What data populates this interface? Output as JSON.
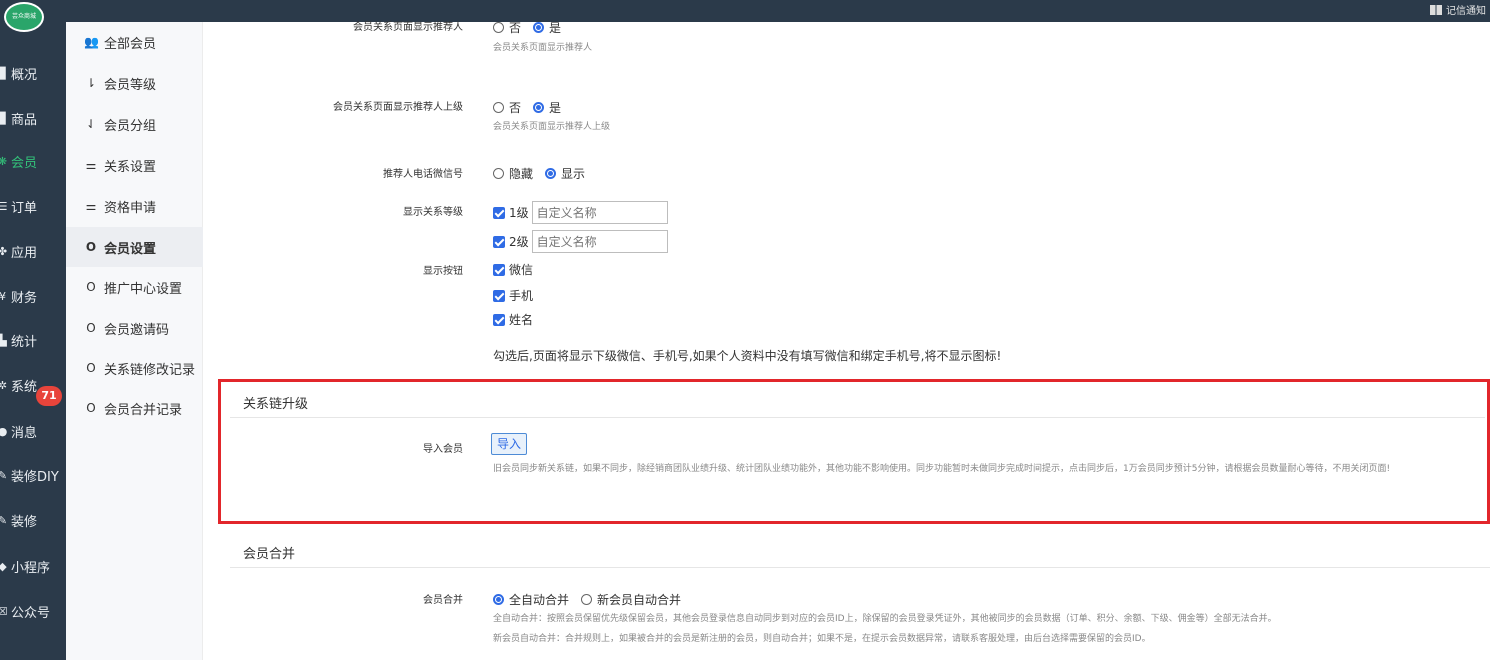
{
  "topbar": {
    "logo_text": "芸众商城",
    "right_text": "记信通知"
  },
  "sidebar": {
    "items": [
      {
        "label": "概况",
        "icon": "overview-icon",
        "glyph": "▉"
      },
      {
        "label": "商品",
        "icon": "goods-icon",
        "glyph": "▉"
      },
      {
        "label": "会员",
        "icon": "member-icon",
        "glyph": "❋"
      },
      {
        "label": "订单",
        "icon": "order-icon",
        "glyph": "☰"
      },
      {
        "label": "应用",
        "icon": "app-icon",
        "glyph": "✤"
      },
      {
        "label": "财务",
        "icon": "finance-icon",
        "glyph": "¥"
      },
      {
        "label": "统计",
        "icon": "stats-icon",
        "glyph": "▙"
      },
      {
        "label": "系统",
        "icon": "system-icon",
        "glyph": "✲"
      },
      {
        "label": "消息",
        "icon": "message-icon",
        "glyph": "●"
      },
      {
        "label": "装修DIY",
        "icon": "diy-icon",
        "glyph": "✎"
      },
      {
        "label": "装修",
        "icon": "decorate-icon",
        "glyph": "✎"
      },
      {
        "label": "小程序",
        "icon": "miniprogram-icon",
        "glyph": "◆"
      },
      {
        "label": "公众号",
        "icon": "official-account-icon",
        "glyph": "☒"
      }
    ],
    "active_index": 2,
    "message_badge": "71"
  },
  "submenu": {
    "items": [
      {
        "label": "全部会员",
        "glyph": "👥"
      },
      {
        "label": "会员等级",
        "glyph": "⇂"
      },
      {
        "label": "会员分组",
        "glyph": "⇃"
      },
      {
        "label": "关系设置",
        "glyph": "⚌"
      },
      {
        "label": "资格申请",
        "glyph": "⚌"
      },
      {
        "label": "会员设置",
        "glyph": "O"
      },
      {
        "label": "推广中心设置",
        "glyph": "O"
      },
      {
        "label": "会员邀请码",
        "glyph": "O"
      },
      {
        "label": "关系链修改记录",
        "glyph": "O"
      },
      {
        "label": "会员合并记录",
        "glyph": "O"
      }
    ],
    "current_index": 5
  },
  "form": {
    "show_referrer": {
      "label": "会员关系页面显示推荐人",
      "options": [
        "否",
        "是"
      ],
      "selected": "是",
      "help": "会员关系页面显示推荐人"
    },
    "show_referrer_parent": {
      "label": "会员关系页面显示推荐人上级",
      "options": [
        "否",
        "是"
      ],
      "selected": "是",
      "help": "会员关系页面显示推荐人上级"
    },
    "referrer_contact": {
      "label": "推荐人电话微信号",
      "options": [
        "隐藏",
        "显示"
      ],
      "selected": "显示"
    },
    "relation_levels": {
      "label": "显示关系等级",
      "levels": [
        {
          "label": "1级",
          "placeholder": "自定义名称",
          "checked": true
        },
        {
          "label": "2级",
          "placeholder": "自定义名称",
          "checked": true
        }
      ]
    },
    "display_buttons": {
      "label": "显示按钮",
      "items": [
        {
          "label": "微信",
          "checked": true
        },
        {
          "label": "手机",
          "checked": true
        },
        {
          "label": "姓名",
          "checked": true
        }
      ],
      "notice": "勾选后,页面将显示下级微信、手机号,如果个人资料中没有填写微信和绑定手机号,将不显示图标!"
    }
  },
  "chain_upgrade": {
    "title": "关系链升级",
    "import_label": "导入会员",
    "import_button": "导入",
    "help": "旧会员同步新关系链，如果不同步，除经销商团队业绩升级、统计团队业绩功能外，其他功能不影响使用。同步功能暂时未做同步完成时间提示，点击同步后，1万会员同步预计5分钟，请根据会员数量耐心等待，不用关闭页面!"
  },
  "member_merge": {
    "title": "会员合并",
    "label": "会员合并",
    "options": [
      "全自动合并",
      "新会员自动合并"
    ],
    "selected": "全自动合并",
    "help1": "全自动合并：按照会员保留优先级保留会员，其他会员登录信息自动同步到对应的会员ID上，除保留的会员登录凭证外，其他被同步的会员数据（订单、积分、余额、下级、佣金等）全部无法合并。",
    "help2": "新会员自动合并：合并规则上，如果被合并的会员是新注册的会员，则自动合并；如果不是，在提示会员数据异常，请联系客服处理，由后台选择需要保留的会员ID。"
  },
  "colors": {
    "sidebar_bg": "#2b3a4a",
    "active_green": "#33c27a",
    "accent_blue": "#2f6be5",
    "highlight_red": "#e2262b",
    "badge_red": "#e8443b"
  }
}
